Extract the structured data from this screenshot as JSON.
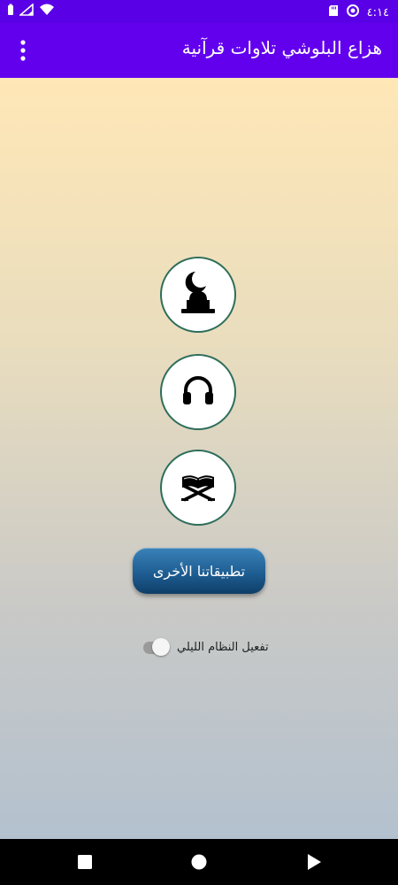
{
  "status_bar": {
    "time": "٤:١٤",
    "icons": [
      "battery-icon",
      "signal-icon",
      "wifi-icon",
      "sd-card-icon",
      "data-saver-icon"
    ]
  },
  "app_bar": {
    "title": "هزاع البلوشي تلاوات قرآنية",
    "menu_icon": "overflow-menu-icon"
  },
  "main": {
    "buttons": [
      {
        "icon": "mosque-crescent-icon"
      },
      {
        "icon": "headphones-icon"
      },
      {
        "icon": "quran-book-icon"
      }
    ],
    "other_apps_label": "تطبيقاتنا الأخرى",
    "night_mode": {
      "label": "تفعيل النظام الليلي",
      "enabled": false
    }
  },
  "nav_bar": {
    "icons": [
      "recents-icon",
      "home-icon",
      "back-icon"
    ]
  },
  "colors": {
    "status_bar": "#5A00E6",
    "app_bar": "#6200EE",
    "circle_border": "#2E6E5A",
    "button_top": "#3A82B8",
    "button_bottom": "#0F3E68",
    "gradient_top": "#FFE7B6",
    "gradient_bottom": "#B3C1CE"
  }
}
